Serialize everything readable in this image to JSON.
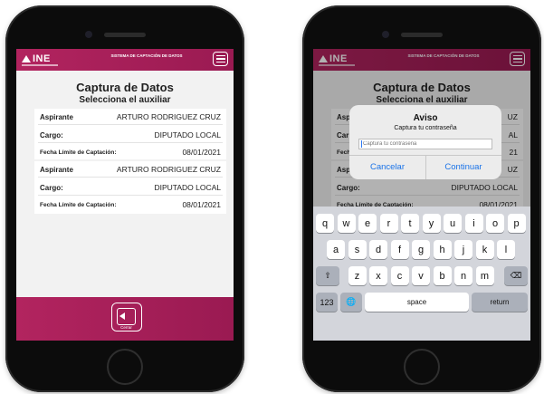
{
  "app": {
    "logo_text": "INE",
    "system_title": "SISTEMA DE CAPTACIÓN DE DATOS",
    "page_title": "Captura de Datos",
    "page_subtitle": "Selecciona el auxiliar"
  },
  "records": [
    {
      "aspirante_label": "Aspirante",
      "aspirante_value": "ARTURO RODRIGUEZ CRUZ",
      "cargo_label": "Cargo:",
      "cargo_value": "DIPUTADO LOCAL",
      "fecha_label": "Fecha Límite de Captación:",
      "fecha_value": "08/01/2021"
    },
    {
      "aspirante_label": "Aspirante",
      "aspirante_value": "ARTURO RODRIGUEZ CRUZ",
      "cargo_label": "Cargo:",
      "cargo_value": "DIPUTADO LOCAL",
      "fecha_label": "Fecha Límite de Captación:",
      "fecha_value": "08/01/2021"
    }
  ],
  "right_partial": {
    "aspirante_label": "Asp",
    "aspirante_value": "UZ",
    "cargo_label": "Car",
    "cargo_value": "AL",
    "fecha_label": "Fech",
    "fecha_value": "21"
  },
  "footer": {
    "exit_label": "Cerrar"
  },
  "alert": {
    "title": "Aviso",
    "message": "Captura tu contraseña",
    "input_placeholder": "Captura tu contraseña",
    "cancel_label": "Cancelar",
    "continue_label": "Continuar"
  },
  "keyboard": {
    "row1": [
      "q",
      "w",
      "e",
      "r",
      "t",
      "y",
      "u",
      "i",
      "o",
      "p"
    ],
    "row2": [
      "a",
      "s",
      "d",
      "f",
      "g",
      "h",
      "j",
      "k",
      "l"
    ],
    "row3": [
      "z",
      "x",
      "c",
      "v",
      "b",
      "n",
      "m"
    ],
    "shift_symbol": "⇧",
    "delete_symbol": "⌫",
    "numbers_label": "123",
    "globe_symbol": "🌐",
    "space_label": "space",
    "return_label": "return"
  },
  "colors": {
    "brand": "#b2245f",
    "link_blue": "#1a73e8"
  }
}
